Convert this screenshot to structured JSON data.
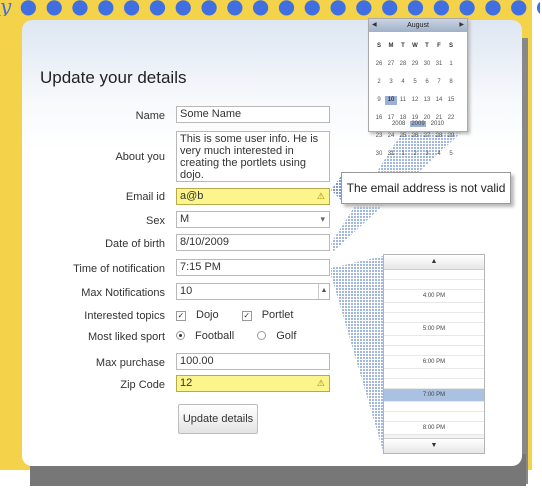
{
  "banner": {
    "text": "y ● ● ● ● ● ● ● ● ● ● ● ● ● ● ● ● ● ● ● ● ● ●"
  },
  "form": {
    "title": "Update your details",
    "name_label": "Name",
    "name_value": "Some Name",
    "about_label": "About you",
    "about_value": "This is some user info. He is very much interested in creating the portlets using dojo.",
    "email_label": "Email id",
    "email_value": "a@b",
    "sex_label": "Sex",
    "sex_value": "M",
    "dob_label": "Date of birth",
    "dob_value": "8/10/2009",
    "time_label": "Time of notification",
    "time_value": "7:15 PM",
    "max_label": "Max Notifications",
    "max_value": "10",
    "topics_label": "Interested topics",
    "topic_dojo": "Dojo",
    "topic_portlet": "Portlet",
    "sport_label": "Most liked sport",
    "sport_football": "Football",
    "sport_golf": "Golf",
    "purchase_label": "Max purchase",
    "purchase_value": "100.00",
    "zip_label": "Zip Code",
    "zip_value": "12",
    "update_button": "Update details"
  },
  "tooltip": {
    "text": "The email address is not valid"
  },
  "calendar": {
    "month": "August",
    "weekdays": [
      "S",
      "M",
      "T",
      "W",
      "T",
      "F",
      "S"
    ],
    "weeks": [
      [
        "26",
        "27",
        "28",
        "29",
        "30",
        "31",
        "1"
      ],
      [
        "2",
        "3",
        "4",
        "5",
        "6",
        "7",
        "8"
      ],
      [
        "9",
        "10",
        "11",
        "12",
        "13",
        "14",
        "15"
      ],
      [
        "16",
        "17",
        "18",
        "19",
        "20",
        "21",
        "22"
      ],
      [
        "23",
        "24",
        "25",
        "26",
        "27",
        "28",
        "29"
      ],
      [
        "30",
        "31",
        "1",
        "2",
        "3",
        "4",
        "5"
      ]
    ],
    "selected_day": "10",
    "years": [
      "2008",
      "2009",
      "2010"
    ],
    "selected_year": "2009"
  },
  "timepicker": {
    "times": [
      "4:00 PM",
      "5:00 PM",
      "6:00 PM",
      "7:00 PM",
      "8:00 PM"
    ],
    "selected_time": "7:00 PM"
  },
  "colors": {
    "frame": "#f4d24a",
    "invalid_field": "#fbf58c",
    "selection": "#9bb0d6"
  }
}
